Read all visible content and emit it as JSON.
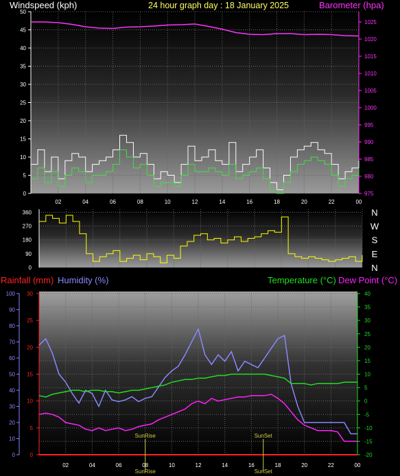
{
  "colors": {
    "wind": "#ffffff",
    "wind_avg": "#44dd44",
    "barometer": "#ff33ff",
    "direction": "#ffff00",
    "rainfall": "#ff2222",
    "humidity": "#8888ff",
    "temperature": "#22dd22",
    "dewpoint": "#ff22ff",
    "title": "#ffff66",
    "sun_marker": "#cccc44"
  },
  "chart_data": [
    {
      "type": "line",
      "title": "24 hour graph day : 18 January 2025",
      "y_left_label": "Windspeed (kph)",
      "y_right_label": "Barometer (hpa)",
      "y_left_ticks": [
        "0",
        "5",
        "10",
        "15",
        "20",
        "25",
        "30",
        "35",
        "40",
        "45",
        "50"
      ],
      "y_left_range": [
        0,
        50
      ],
      "y_right_ticks": [
        "975",
        "980",
        "985",
        "990",
        "995",
        "1000",
        "1005",
        "1010",
        "1015",
        "1020",
        "1025"
      ],
      "y_right_range": [
        975,
        1028
      ],
      "x_ticks": [
        "02",
        "04",
        "06",
        "08",
        "10",
        "12",
        "14",
        "16",
        "18",
        "20",
        "22",
        "00"
      ],
      "x_range_hours": [
        0,
        24
      ],
      "grid": true,
      "series": [
        {
          "key": "barometer",
          "axis": "right",
          "x": [
            0,
            1,
            2,
            3,
            4,
            5,
            6,
            7,
            8,
            9,
            10,
            11,
            12,
            13,
            14,
            15,
            16,
            17,
            18,
            19,
            20,
            21,
            22,
            23,
            24
          ],
          "y": [
            1025,
            1025,
            1024.8,
            1024.3,
            1023.6,
            1023.2,
            1023.1,
            1023.5,
            1023.6,
            1023.8,
            1024.1,
            1024.2,
            1024.4,
            1023.7,
            1022.9,
            1021.9,
            1021.4,
            1021.3,
            1021.6,
            1021.6,
            1021.3,
            1021.4,
            1021.3,
            1021.0,
            1020.9
          ]
        },
        {
          "key": "wind_gust",
          "axis": "left",
          "x": [
            0,
            0.5,
            1,
            1.5,
            2,
            2.5,
            3,
            3.5,
            4,
            4.5,
            5,
            5.5,
            6,
            6.5,
            7,
            7.5,
            8,
            8.5,
            9,
            9.5,
            10,
            10.5,
            11,
            11.5,
            12,
            12.5,
            13,
            13.5,
            14,
            14.5,
            15,
            15.5,
            16,
            16.5,
            17,
            17.5,
            18,
            18.5,
            19,
            19.5,
            20,
            20.5,
            21,
            21.5,
            22,
            22.5,
            23,
            23.5,
            24
          ],
          "y": [
            8,
            12,
            6,
            10,
            4,
            9,
            11,
            10,
            6,
            8,
            9,
            10,
            12,
            16,
            14,
            10,
            11,
            8,
            4,
            6,
            5,
            3,
            8,
            13,
            9,
            10,
            12,
            9,
            8,
            14,
            6,
            8,
            10,
            12,
            7,
            3,
            1,
            5,
            10,
            12,
            13,
            14,
            12,
            11,
            8,
            4,
            6,
            7,
            9
          ]
        },
        {
          "key": "wind_avg",
          "axis": "left",
          "x": [
            0,
            0.5,
            1,
            1.5,
            2,
            2.5,
            3,
            3.5,
            4,
            4.5,
            5,
            5.5,
            6,
            6.5,
            7,
            7.5,
            8,
            8.5,
            9,
            9.5,
            10,
            10.5,
            11,
            11.5,
            12,
            12.5,
            13,
            13.5,
            14,
            14.5,
            15,
            15.5,
            16,
            16.5,
            17,
            17.5,
            18,
            18.5,
            19,
            19.5,
            20,
            20.5,
            21,
            21.5,
            22,
            22.5,
            23,
            23.5,
            24
          ],
          "y": [
            4,
            7,
            3,
            6,
            2,
            5,
            7,
            6,
            3,
            5,
            5,
            6,
            8,
            12,
            10,
            7,
            8,
            5,
            2,
            3,
            3,
            2,
            5,
            8,
            6,
            6,
            7,
            6,
            5,
            8,
            4,
            5,
            6,
            7,
            4,
            1,
            0,
            3,
            6,
            8,
            9,
            10,
            9,
            8,
            5,
            2,
            4,
            5,
            7
          ]
        }
      ]
    },
    {
      "type": "line",
      "y_left_ticks": [
        "0",
        "90",
        "180",
        "270",
        "360"
      ],
      "y_left_range": [
        0,
        380
      ],
      "y_right_ticks": [
        "N",
        "W",
        "S",
        "E",
        "N"
      ],
      "x_range_hours": [
        0,
        24
      ],
      "series": [
        {
          "key": "direction",
          "x": [
            0,
            0.5,
            1,
            1.5,
            2,
            2.5,
            3,
            3.5,
            4,
            4.5,
            5,
            5.5,
            6,
            6.5,
            7,
            7.5,
            8,
            8.5,
            9,
            9.5,
            10,
            10.5,
            11,
            11.5,
            12,
            12.5,
            13,
            13.5,
            14,
            14.5,
            15,
            15.5,
            16,
            16.5,
            17,
            17.5,
            18,
            18.5,
            19,
            19.5,
            20,
            20.5,
            21,
            21.5,
            22,
            22.5,
            23,
            23.5,
            24
          ],
          "y": [
            300,
            340,
            320,
            290,
            340,
            300,
            220,
            90,
            40,
            70,
            90,
            110,
            40,
            60,
            80,
            50,
            90,
            70,
            30,
            80,
            60,
            140,
            170,
            210,
            220,
            180,
            190,
            160,
            180,
            200,
            170,
            190,
            200,
            220,
            240,
            230,
            330,
            90,
            70,
            60,
            70,
            60,
            50,
            40,
            50,
            60,
            70,
            40,
            80
          ]
        }
      ]
    },
    {
      "type": "line",
      "y_left_label": "Rainfall (mm)",
      "y_left2_label": "Humidity (%)",
      "y_right_label": "Temperature (°C)",
      "y_right2_label": "Dew Point (°C)",
      "humidity_ticks": [
        "0",
        "10",
        "20",
        "30",
        "40",
        "50",
        "60",
        "70",
        "80",
        "90",
        "100"
      ],
      "rain_ticks": [
        "0",
        "5",
        "10",
        "15",
        "20",
        "25",
        "30"
      ],
      "temp_ticks": [
        "-20",
        "-15",
        "-10",
        "-5",
        "0",
        "5",
        "10",
        "15",
        "20",
        "25",
        "30",
        "35",
        "40"
      ],
      "x_ticks": [
        "02",
        "04",
        "06",
        "08",
        "10",
        "12",
        "14",
        "16",
        "18",
        "20",
        "22",
        "00"
      ],
      "x_range_hours": [
        0,
        24
      ],
      "annotations": [
        {
          "label": "SunRise",
          "hour": 8.0
        },
        {
          "label": "SunSet",
          "hour": 16.9
        }
      ],
      "bottom_labels": [
        "SunRise",
        "SunSet"
      ],
      "series": [
        {
          "key": "humidity",
          "axis": "humidity",
          "x": [
            0,
            0.5,
            1,
            1.5,
            2,
            2.5,
            3,
            3.5,
            4,
            4.5,
            5,
            5.5,
            6,
            6.5,
            7,
            7.5,
            8,
            8.5,
            9,
            9.5,
            10,
            10.5,
            11,
            11.5,
            12,
            12.5,
            13,
            13.5,
            14,
            14.5,
            15,
            15.5,
            16,
            16.5,
            17,
            17.5,
            18,
            18.5,
            19,
            19.5,
            20,
            20.5,
            21,
            21.5,
            22,
            22.5,
            23,
            23.5,
            24
          ],
          "y": [
            68,
            72,
            63,
            50,
            45,
            38,
            32,
            40,
            38,
            30,
            40,
            34,
            33,
            34,
            36,
            33,
            35,
            36,
            42,
            48,
            52,
            55,
            62,
            70,
            78,
            62,
            56,
            62,
            58,
            64,
            52,
            58,
            56,
            54,
            60,
            66,
            72,
            74,
            44,
            30,
            20,
            20,
            20,
            20,
            20,
            20,
            20,
            13,
            13
          ]
        },
        {
          "key": "rainfall",
          "axis": "rain",
          "x": [
            0,
            24
          ],
          "y": [
            0,
            0
          ]
        },
        {
          "key": "temperature",
          "axis": "temp",
          "x": [
            0,
            0.5,
            1,
            1.5,
            2,
            2.5,
            3,
            3.5,
            4,
            4.5,
            5,
            5.5,
            6,
            6.5,
            7,
            7.5,
            8,
            8.5,
            9,
            9.5,
            10,
            10.5,
            11,
            11.5,
            12,
            12.5,
            13,
            13.5,
            14,
            14.5,
            15,
            15.5,
            16,
            16.5,
            17,
            17.5,
            18,
            18.5,
            19,
            19.5,
            20,
            20.5,
            21,
            21.5,
            22,
            22.5,
            23,
            23.5,
            24
          ],
          "y": [
            2,
            1.5,
            2.5,
            3,
            3.5,
            4,
            4,
            3.5,
            4,
            4,
            3.5,
            3.5,
            3,
            3.5,
            4,
            4,
            4.5,
            5,
            5.5,
            6,
            7,
            7.5,
            8,
            8,
            8.5,
            8.5,
            9,
            9.5,
            9.5,
            10,
            10,
            10,
            10,
            10,
            10,
            9.5,
            9,
            8.5,
            6.5,
            6.5,
            6.5,
            6,
            6.5,
            6.5,
            6.5,
            6.5,
            7,
            7,
            7
          ]
        },
        {
          "key": "dewpoint",
          "axis": "temp",
          "x": [
            0,
            0.5,
            1,
            1.5,
            2,
            2.5,
            3,
            3.5,
            4,
            4.5,
            5,
            5.5,
            6,
            6.5,
            7,
            7.5,
            8,
            8.5,
            9,
            9.5,
            10,
            10.5,
            11,
            11.5,
            12,
            12.5,
            13,
            13.5,
            14,
            14.5,
            15,
            15.5,
            16,
            16.5,
            17,
            17.5,
            18,
            18.5,
            19,
            19.5,
            20,
            20.5,
            21,
            21.5,
            22,
            22.5,
            23,
            23.5,
            24
          ],
          "y": [
            -5,
            -4.5,
            -5,
            -6,
            -8,
            -8.5,
            -9,
            -10.5,
            -11,
            -10,
            -11,
            -10.5,
            -10,
            -11,
            -10.5,
            -9.5,
            -9,
            -8.5,
            -7,
            -6,
            -5,
            -4,
            -3,
            -1,
            0,
            -1,
            1,
            0,
            0.5,
            1,
            1.5,
            1.5,
            2,
            2,
            2,
            2.5,
            1,
            -1,
            -4,
            -7,
            -9,
            -10,
            -11,
            -11,
            -11,
            -11.5,
            -15,
            -15,
            -15
          ]
        }
      ]
    }
  ]
}
